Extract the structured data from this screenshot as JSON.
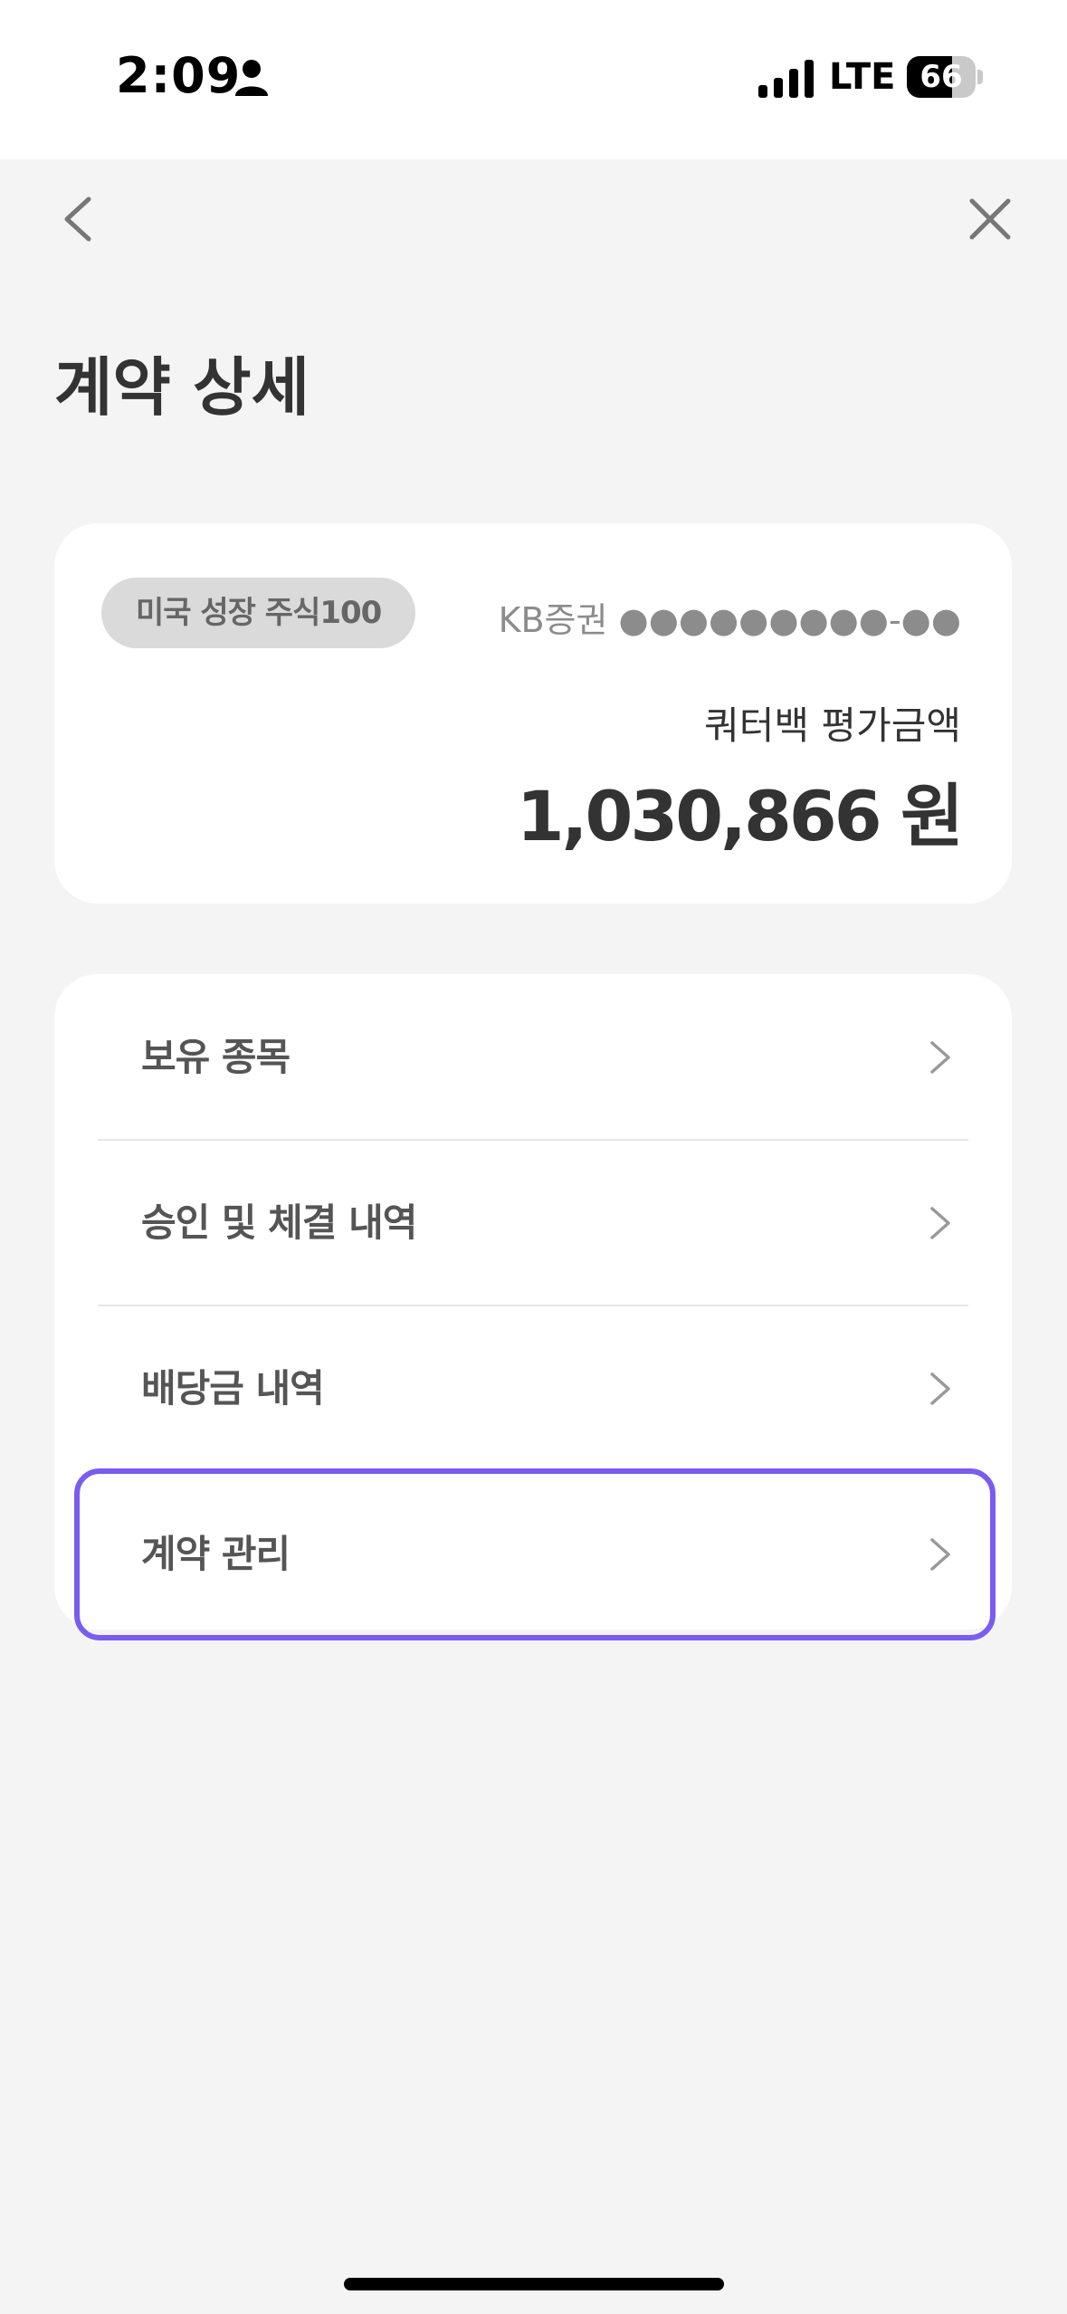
{
  "status_bar": {
    "time": "2:09",
    "network": "LTE",
    "battery": "66",
    "battery_level": 0.66,
    "icons": [
      "person-icon",
      "signal-icon",
      "battery-icon"
    ]
  },
  "nav": {
    "back_icon": "chevron-left-icon",
    "close_icon": "close-icon"
  },
  "page": {
    "title": "계약 상세"
  },
  "summary": {
    "product_tag": "미국 성장 주식100",
    "account": "KB증권 ●●●●●●●●●-●●",
    "value_label": "쿼터백 평가금액",
    "value_amount": "1,030,866 원"
  },
  "menu": {
    "items": [
      {
        "label": "보유 종목"
      },
      {
        "label": "승인 및 체결 내역"
      },
      {
        "label": "배당금 내역"
      },
      {
        "label": "계약 관리"
      }
    ],
    "chevron_icon": "chevron-right-icon"
  },
  "colors": {
    "background": "#f4f4f4",
    "card": "#ffffff",
    "highlight": "#7b5cf0",
    "tag_bg": "#dadada"
  }
}
